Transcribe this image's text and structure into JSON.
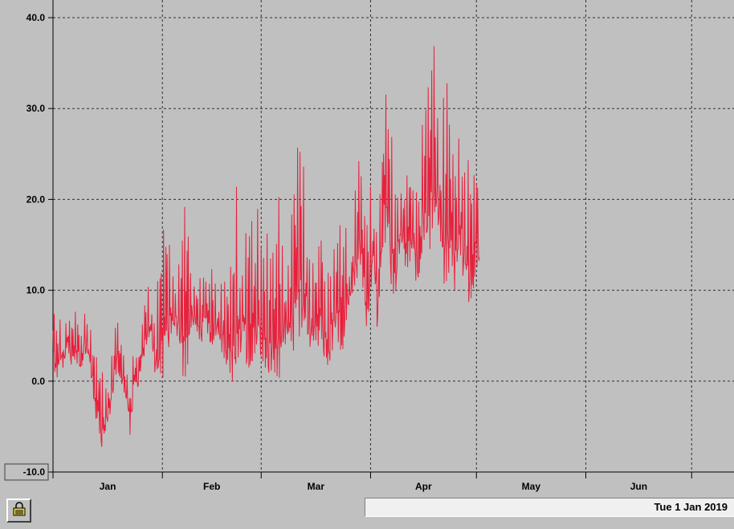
{
  "chart_data": {
    "type": "line",
    "series_color": "#e8203c",
    "grid": true,
    "ylim": [
      -10,
      40
    ],
    "yticks": [
      {
        "value": 40,
        "label": "40.0"
      },
      {
        "value": 30,
        "label": "30.0"
      },
      {
        "value": 20,
        "label": "20.0"
      },
      {
        "value": 10,
        "label": "10.0"
      },
      {
        "value": 0,
        "label": "0.0"
      },
      {
        "value": -10,
        "label": "-10.0"
      }
    ],
    "x_range_days": [
      0,
      193
    ],
    "xticks": [
      {
        "day": 0,
        "label": "Jan"
      },
      {
        "day": 31,
        "label": "Feb"
      },
      {
        "day": 59,
        "label": "Mar"
      },
      {
        "day": 90,
        "label": "Apr"
      },
      {
        "day": 120,
        "label": "May"
      },
      {
        "day": 151,
        "label": "Jun"
      },
      {
        "day": 181,
        "label": ""
      }
    ],
    "daily_series": [
      [
        0,
        8.5,
        2
      ],
      [
        1,
        6,
        0
      ],
      [
        2,
        7,
        2
      ],
      [
        3,
        5,
        1
      ],
      [
        4,
        8,
        4
      ],
      [
        5,
        6,
        2
      ],
      [
        6,
        8,
        1
      ],
      [
        7,
        7,
        2
      ],
      [
        8,
        5,
        1
      ],
      [
        9,
        9,
        3
      ],
      [
        10,
        7,
        2
      ],
      [
        11,
        5,
        0
      ],
      [
        12,
        3,
        -4
      ],
      [
        13,
        2,
        -6
      ],
      [
        14,
        1,
        -8.5
      ],
      [
        15,
        0,
        -5
      ],
      [
        16,
        1,
        -4
      ],
      [
        17,
        4,
        -2
      ],
      [
        18,
        7.5,
        1
      ],
      [
        19,
        5,
        0
      ],
      [
        20,
        3,
        -1
      ],
      [
        21,
        1,
        -3
      ],
      [
        22,
        2,
        -6.5
      ],
      [
        23,
        4,
        0
      ],
      [
        24,
        2,
        -1
      ],
      [
        25,
        5,
        1
      ],
      [
        26,
        9,
        3
      ],
      [
        27,
        10.5,
        5
      ],
      [
        28,
        9,
        4
      ],
      [
        29,
        7,
        0
      ],
      [
        30,
        13,
        1
      ],
      [
        31,
        16,
        0
      ],
      [
        32,
        18,
        2
      ],
      [
        33,
        15,
        4
      ],
      [
        34,
        13,
        6
      ],
      [
        35,
        11,
        5
      ],
      [
        36,
        14,
        3
      ],
      [
        37,
        19,
        0
      ],
      [
        38,
        20.5,
        1
      ],
      [
        39,
        12,
        5
      ],
      [
        40,
        11,
        6
      ],
      [
        41,
        13.5,
        5
      ],
      [
        42,
        11,
        4
      ],
      [
        43,
        12,
        6
      ],
      [
        44,
        10,
        5
      ],
      [
        45,
        13,
        3
      ],
      [
        46,
        11,
        5
      ],
      [
        47,
        10,
        4
      ],
      [
        48,
        13,
        3
      ],
      [
        49,
        10,
        2
      ],
      [
        50,
        12,
        0
      ],
      [
        51,
        14,
        -1.5
      ],
      [
        52,
        21.5,
        2
      ],
      [
        53,
        13,
        3
      ],
      [
        54,
        15,
        4
      ],
      [
        55,
        17,
        1
      ],
      [
        56,
        20,
        0
      ],
      [
        57,
        13,
        3
      ],
      [
        58,
        19,
        2
      ],
      [
        59,
        17,
        3
      ],
      [
        60,
        22.5,
        1
      ],
      [
        61,
        14,
        0
      ],
      [
        62,
        15,
        -0.5
      ],
      [
        63,
        14,
        1
      ],
      [
        64,
        21,
        0
      ],
      [
        65,
        16,
        2
      ],
      [
        66,
        13,
        4
      ],
      [
        67,
        14,
        5
      ],
      [
        68,
        21,
        3
      ],
      [
        69,
        25.5,
        4
      ],
      [
        70,
        27.5,
        5
      ],
      [
        71,
        24,
        6
      ],
      [
        72,
        18,
        5
      ],
      [
        73,
        15,
        1.5
      ],
      [
        74,
        12,
        5
      ],
      [
        75,
        13,
        4
      ],
      [
        76,
        18.5,
        3
      ],
      [
        77,
        11,
        2
      ],
      [
        78,
        15,
        1
      ],
      [
        79,
        16,
        3
      ],
      [
        80,
        14,
        5
      ],
      [
        81,
        18,
        4
      ],
      [
        82,
        16,
        2
      ],
      [
        83,
        17,
        6
      ],
      [
        84,
        12,
        8
      ],
      [
        85,
        18,
        10
      ],
      [
        86,
        23.5,
        11
      ],
      [
        87,
        25.5,
        12
      ],
      [
        88,
        19,
        9
      ],
      [
        89,
        18,
        5
      ],
      [
        90,
        22,
        10
      ],
      [
        91,
        20,
        12
      ],
      [
        92,
        17,
        4.5
      ],
      [
        93,
        22.5,
        13
      ],
      [
        94,
        32.5,
        15
      ],
      [
        95,
        30,
        14
      ],
      [
        96,
        27,
        10
      ],
      [
        97,
        25,
        9
      ],
      [
        98,
        22,
        13
      ],
      [
        99,
        20,
        15
      ],
      [
        100,
        22,
        12
      ],
      [
        101,
        24,
        13
      ],
      [
        102,
        21,
        14
      ],
      [
        103,
        23,
        10
      ],
      [
        104,
        26,
        11
      ],
      [
        105,
        30,
        16
      ],
      [
        106,
        32,
        12
      ],
      [
        107,
        35,
        15
      ],
      [
        108,
        37.5,
        18
      ],
      [
        109,
        30,
        17
      ],
      [
        110,
        28,
        13
      ],
      [
        111,
        36,
        10
      ],
      [
        112,
        32,
        12
      ],
      [
        113,
        26,
        11
      ],
      [
        114,
        24,
        9
      ],
      [
        115,
        27,
        15
      ],
      [
        116,
        28,
        12
      ],
      [
        117,
        25,
        9
      ],
      [
        118,
        24,
        8.5
      ],
      [
        119,
        22,
        9
      ],
      [
        120,
        24,
        12
      ]
    ]
  },
  "status_bar": {
    "date_text": "Tue 1 Jan 2019",
    "lock_icon": "padlock-icon",
    "axis_minimum_label": "-10.0"
  }
}
